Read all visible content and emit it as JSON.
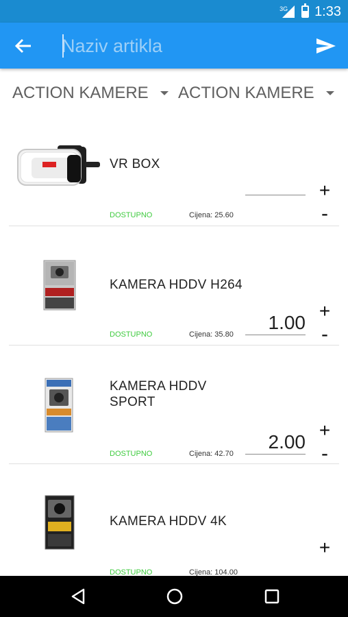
{
  "status_bar": {
    "time": "1:33",
    "network": "3G"
  },
  "app_bar": {
    "search_placeholder": "Naziv artikla",
    "back_icon": "arrow-left-icon",
    "send_icon": "send-icon"
  },
  "filters": {
    "category_1": "ACTION KAMERE",
    "category_2": "ACTION KAMERE"
  },
  "products": [
    {
      "name": "VR BOX",
      "status": "DOSTUPNO",
      "price": "Cijena: 25.60",
      "quantity": "",
      "plus": "+",
      "minus": "-"
    },
    {
      "name": "KAMERA HDDV H264",
      "status": "DOSTUPNO",
      "price": "Cijena: 35.80",
      "quantity": "1.00",
      "plus": "+",
      "minus": "-"
    },
    {
      "name": "KAMERA HDDV\nSPORT",
      "status": "DOSTUPNO",
      "price": "Cijena: 42.70",
      "quantity": "2.00",
      "plus": "+",
      "minus": "-"
    },
    {
      "name": "KAMERA HDDV 4K",
      "status": "DOSTUPNO",
      "price": "Cijena: 104.00",
      "quantity": "",
      "plus": "+",
      "minus": "-"
    }
  ],
  "colors": {
    "status_bar": "#1a8bd0",
    "app_bar": "#2196f3",
    "available_green": "#3fcb3f"
  }
}
